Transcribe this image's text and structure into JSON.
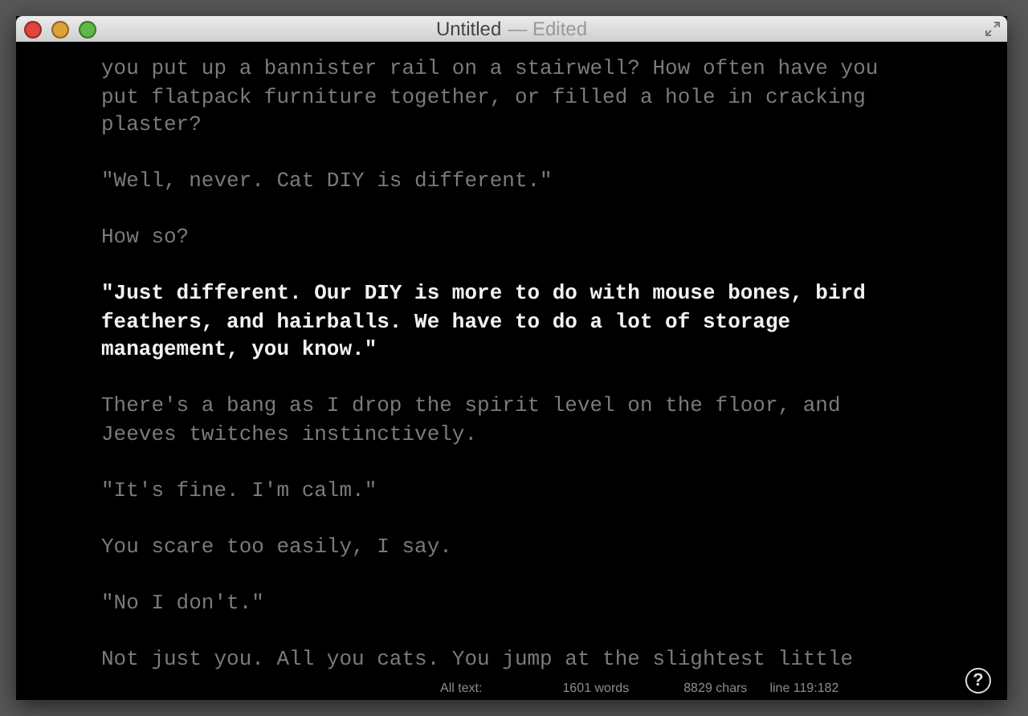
{
  "window": {
    "title": "Untitled",
    "subtitle": "— Edited"
  },
  "paragraphs": [
    {
      "text": "you put up a bannister rail on a stairwell? How often have you put flatpack furniture together, or filled a hole in cracking plaster?",
      "focused": false
    },
    {
      "text": "\"Well, never. Cat DIY is different.\"",
      "focused": false
    },
    {
      "text": "How so?",
      "focused": false
    },
    {
      "text": "\"Just different. Our DIY is more to do with mouse bones, bird feathers, and hairballs. We have to do a lot of storage management, you know.\"",
      "focused": true
    },
    {
      "text": "There's a bang as I drop the spirit level on the floor, and Jeeves twitches instinctively.",
      "focused": false
    },
    {
      "text": "\"It's fine. I'm calm.\"",
      "focused": false
    },
    {
      "text": "You scare too easily, I say.",
      "focused": false
    },
    {
      "text": "\"No I don't.\"",
      "focused": false
    },
    {
      "text": "Not just you. All you cats. You jump at the slightest little",
      "focused": false
    }
  ],
  "help_button": {
    "label": "?"
  },
  "status_bar": {
    "scope": "All text:",
    "words": "1601 words",
    "chars": "8829 chars",
    "position": "line 119:182"
  }
}
